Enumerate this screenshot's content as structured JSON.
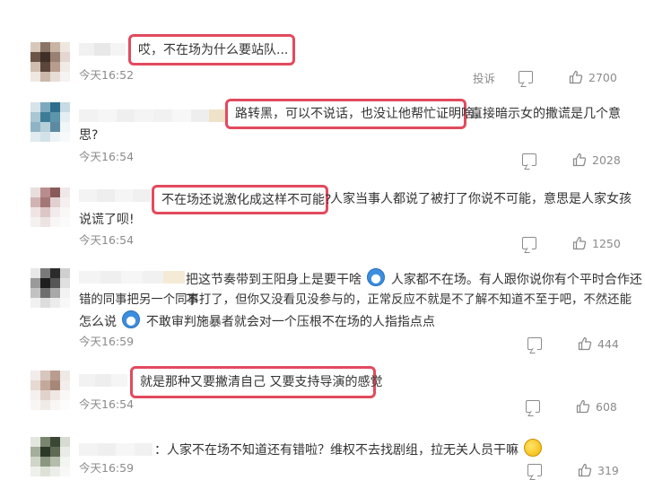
{
  "comments": [
    {
      "time": "今天16:52",
      "highlight": "哎，不在场为什么要站队...",
      "text_lines": [],
      "report": "投诉",
      "likes": "2700"
    },
    {
      "time": "今天16:54",
      "highlight": "路转黑，可以不说话，也没让他帮忙证明啥，",
      "text_lines": [
        "直接暗示女的撒谎是几个意",
        "思?"
      ],
      "likes": "2028"
    },
    {
      "time": "今天16:54",
      "highlight": "不在场还说激化成这样不可能?",
      "text_lines": [
        "人家当事人都说了被打了你说不可能，意思是人家女孩",
        "说谎了呗!"
      ],
      "likes": "1250"
    },
    {
      "time": "今天16:59",
      "highlight": "",
      "text_lines": [
        "把这节奏带到王阳身上是要干啥",
        "人家都不在场。有人跟你说你有个平时合作还不",
        "错的同事把另一个同事打了，但你又没看见没参与的，正常反应不就是不了解不知道不至于吧，不然还能",
        "怎么说",
        "不敢审判施暴者就会对一个压根不在场的人指指点点"
      ],
      "likes": "444"
    },
    {
      "time": "今天16:54",
      "highlight": "就是那种又要撇清自己 又要支持导演的感觉",
      "text_lines": [],
      "likes": "608"
    },
    {
      "time": "今天16:59",
      "highlight": "",
      "text_lines": [
        "：人家不在场不知道还有错啦？维权不去找剧组，拉无关人员干嘛"
      ],
      "likes": "319"
    }
  ],
  "icons": {
    "comment": "comment-bubble-icon",
    "like": "thumbs-up-icon",
    "emoji_blue": "doraemon-emoji-icon",
    "emoji_yellow": "thinking-emoji-icon"
  },
  "colors": {
    "highlight_border": "#e24a5e",
    "meta_text": "#8b8b8b",
    "body_text": "#333333"
  }
}
